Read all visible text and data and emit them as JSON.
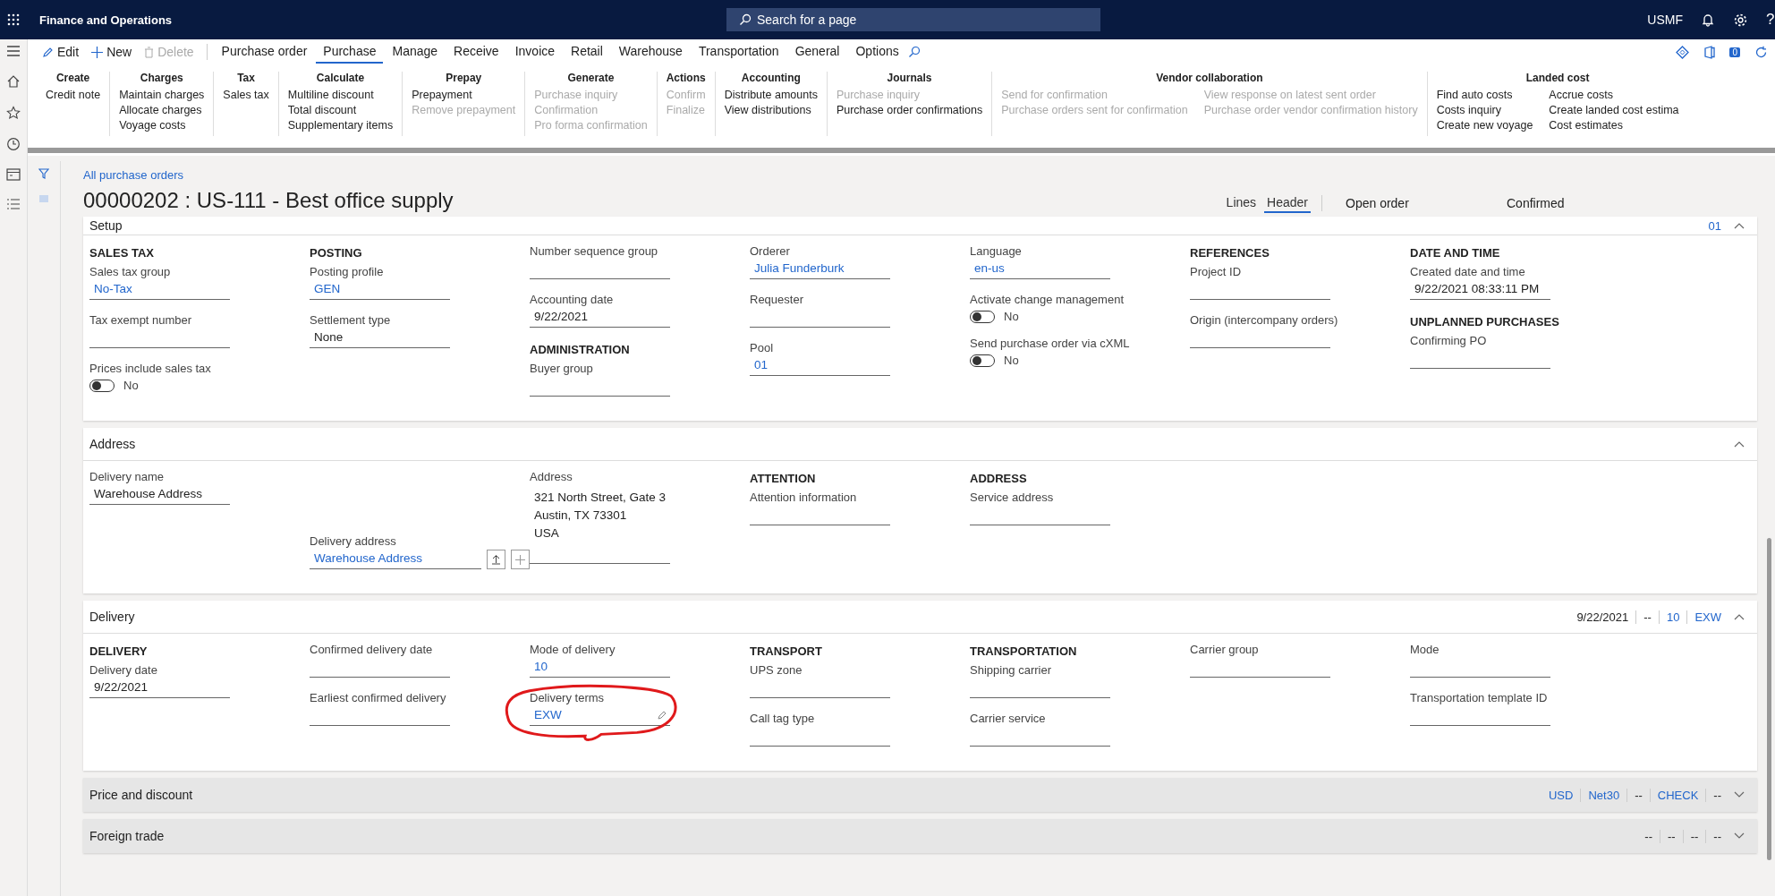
{
  "app": {
    "title": "Finance and Operations",
    "search_placeholder": "Search for a page",
    "company": "USMF",
    "help_label": "?",
    "notification_count": "0"
  },
  "action_bar": {
    "actions": [
      {
        "kind": "edit",
        "label": "Edit",
        "disabled": false
      },
      {
        "kind": "new",
        "label": "New",
        "disabled": false
      },
      {
        "kind": "delete",
        "label": "Delete",
        "disabled": true
      }
    ],
    "tabs": [
      {
        "label": "Purchase order",
        "selected": false
      },
      {
        "label": "Purchase",
        "selected": true
      },
      {
        "label": "Manage",
        "selected": false
      },
      {
        "label": "Receive",
        "selected": false
      },
      {
        "label": "Invoice",
        "selected": false
      },
      {
        "label": "Retail",
        "selected": false
      },
      {
        "label": "Warehouse",
        "selected": false
      },
      {
        "label": "Transportation",
        "selected": false
      },
      {
        "label": "General",
        "selected": false
      },
      {
        "label": "Options",
        "selected": false
      }
    ]
  },
  "ribbon": [
    {
      "title": "Create",
      "columns": [
        [
          {
            "label": "Credit note",
            "disabled": false
          }
        ]
      ]
    },
    {
      "title": "Charges",
      "columns": [
        [
          {
            "label": "Maintain charges",
            "disabled": false
          },
          {
            "label": "Allocate charges",
            "disabled": false
          },
          {
            "label": "Voyage costs",
            "disabled": false
          }
        ]
      ]
    },
    {
      "title": "Tax",
      "columns": [
        [
          {
            "label": "Sales tax",
            "disabled": false
          }
        ]
      ]
    },
    {
      "title": "Calculate",
      "columns": [
        [
          {
            "label": "Multiline discount",
            "disabled": false
          },
          {
            "label": "Total discount",
            "disabled": false
          },
          {
            "label": "Supplementary items",
            "disabled": false
          }
        ]
      ]
    },
    {
      "title": "Prepay",
      "columns": [
        [
          {
            "label": "Prepayment",
            "disabled": false
          },
          {
            "label": "Remove prepayment",
            "disabled": true
          }
        ]
      ]
    },
    {
      "title": "Generate",
      "columns": [
        [
          {
            "label": "Purchase inquiry",
            "disabled": true
          },
          {
            "label": "Confirmation",
            "disabled": true
          },
          {
            "label": "Pro forma confirmation",
            "disabled": true
          }
        ]
      ]
    },
    {
      "title": "Actions",
      "columns": [
        [
          {
            "label": "Confirm",
            "disabled": true
          },
          {
            "label": "Finalize",
            "disabled": true
          }
        ]
      ]
    },
    {
      "title": "Accounting",
      "columns": [
        [
          {
            "label": "Distribute amounts",
            "disabled": false
          },
          {
            "label": "View distributions",
            "disabled": false
          }
        ]
      ]
    },
    {
      "title": "Journals",
      "columns": [
        [
          {
            "label": "Purchase inquiry",
            "disabled": true
          },
          {
            "label": "Purchase order confirmations",
            "disabled": false
          }
        ]
      ]
    },
    {
      "title": "Vendor collaboration",
      "columns": [
        [
          {
            "label": "Send for confirmation",
            "disabled": true
          },
          {
            "label": "Purchase orders sent for confirmation",
            "disabled": true
          }
        ],
        [
          {
            "label": "View response on latest sent order",
            "disabled": true
          },
          {
            "label": "Purchase order vendor confirmation history",
            "disabled": true
          }
        ]
      ]
    },
    {
      "title": "Landed cost",
      "columns": [
        [
          {
            "label": "Find auto costs",
            "disabled": false
          },
          {
            "label": "Costs inquiry",
            "disabled": false
          },
          {
            "label": "Create new voyage",
            "disabled": false
          }
        ],
        [
          {
            "label": "Accrue costs",
            "disabled": false
          },
          {
            "label": "Create landed cost estima",
            "disabled": false
          },
          {
            "label": "Cost estimates",
            "disabled": false
          }
        ]
      ]
    }
  ],
  "header": {
    "breadcrumb": "All purchase orders",
    "title": "00000202 : US-111 - Best office supply",
    "views": [
      {
        "label": "Lines",
        "selected": false
      },
      {
        "label": "Header",
        "selected": true
      }
    ],
    "status": [
      "Open order",
      "Confirmed"
    ]
  },
  "sections": [
    {
      "title": "Setup",
      "expanded": true,
      "summary": [
        {
          "text": "01",
          "link": true
        }
      ],
      "columns": [
        [
          {
            "kind": "heading",
            "text": "SALES TAX"
          },
          {
            "kind": "field",
            "label": "Sales tax group",
            "value": "No-Tax",
            "link": true
          },
          {
            "kind": "field",
            "label": "Tax exempt number"
          },
          {
            "kind": "toggle",
            "label": "Prices include sales tax",
            "on": false,
            "state_text": "No"
          }
        ],
        [
          {
            "kind": "heading",
            "text": "POSTING"
          },
          {
            "kind": "field",
            "label": "Posting profile",
            "value": "GEN",
            "link": true
          },
          {
            "kind": "field",
            "label": "Settlement type",
            "value": "None",
            "link": false
          }
        ],
        [
          {
            "kind": "field",
            "label": "Number sequence group"
          },
          {
            "kind": "field",
            "label": "Accounting date",
            "value": "9/22/2021",
            "link": false
          },
          {
            "kind": "heading",
            "text": "ADMINISTRATION"
          },
          {
            "kind": "field",
            "label": "Buyer group"
          }
        ],
        [
          {
            "kind": "field",
            "label": "Orderer",
            "value": "Julia Funderburk",
            "link": true
          },
          {
            "kind": "field",
            "label": "Requester"
          },
          {
            "kind": "field",
            "label": "Pool",
            "value": "01",
            "link": true
          }
        ],
        [
          {
            "kind": "field",
            "label": "Language",
            "value": "en-us",
            "link": true
          },
          {
            "kind": "toggle",
            "label": "Activate change management",
            "on": false,
            "state_text": "No"
          },
          {
            "kind": "toggle",
            "label": "Send purchase order via cXML",
            "on": false,
            "state_text": "No"
          }
        ],
        [
          {
            "kind": "heading",
            "text": "REFERENCES"
          },
          {
            "kind": "field",
            "label": "Project ID"
          },
          {
            "kind": "field",
            "label": "Origin (intercompany orders)"
          }
        ],
        [
          {
            "kind": "heading",
            "text": "DATE AND TIME"
          },
          {
            "kind": "field",
            "label": "Created date and time",
            "value": "9/22/2021 08:33:11 PM",
            "link": false
          },
          {
            "kind": "heading",
            "text": "UNPLANNED PURCHASES"
          },
          {
            "kind": "field",
            "label": "Confirming PO"
          }
        ]
      ]
    },
    {
      "title": "Address",
      "expanded": true,
      "columns": [
        [
          {
            "kind": "field",
            "label": "Delivery name",
            "value": "Warehouse Address",
            "link": false
          }
        ],
        [
          {
            "kind": "lookup",
            "label": "Delivery address",
            "value": "Warehouse Address",
            "link": true
          }
        ],
        [
          {
            "kind": "address",
            "label": "Address",
            "lines": [
              "321 North Street, Gate 3",
              "Austin, TX 73301",
              "USA"
            ]
          }
        ],
        [
          {
            "kind": "heading",
            "text": "ATTENTION"
          },
          {
            "kind": "field",
            "label": "Attention information"
          }
        ],
        [
          {
            "kind": "heading",
            "text": "ADDRESS"
          },
          {
            "kind": "field",
            "label": "Service address"
          }
        ]
      ]
    },
    {
      "title": "Delivery",
      "expanded": true,
      "summary": [
        {
          "text": "9/22/2021",
          "link": false
        },
        {
          "text": "--",
          "link": false
        },
        {
          "text": "10",
          "link": true
        },
        {
          "text": "EXW",
          "link": true
        }
      ],
      "columns": [
        [
          {
            "kind": "heading",
            "text": "DELIVERY"
          },
          {
            "kind": "field",
            "label": "Delivery date",
            "value": "9/22/2021",
            "link": false
          }
        ],
        [
          {
            "kind": "field",
            "label": "Confirmed delivery date"
          },
          {
            "kind": "field",
            "label": "Earliest confirmed delivery"
          }
        ],
        [
          {
            "kind": "field",
            "label": "Mode of delivery",
            "value": "10",
            "link": true
          },
          {
            "kind": "field",
            "label": "Delivery terms",
            "value": "EXW",
            "link": true,
            "highlighted": true
          }
        ],
        [
          {
            "kind": "heading",
            "text": "TRANSPORT"
          },
          {
            "kind": "field",
            "label": "UPS zone"
          },
          {
            "kind": "field",
            "label": "Call tag type"
          }
        ],
        [
          {
            "kind": "heading",
            "text": "TRANSPORTATION"
          },
          {
            "kind": "field",
            "label": "Shipping carrier"
          },
          {
            "kind": "field",
            "label": "Carrier service"
          }
        ],
        [
          {
            "kind": "field",
            "label": "Carrier group"
          }
        ],
        [
          {
            "kind": "field",
            "label": "Mode"
          },
          {
            "kind": "field",
            "label": "Transportation template ID"
          }
        ]
      ]
    },
    {
      "title": "Price and discount",
      "expanded": false,
      "summary": [
        {
          "text": "USD",
          "link": true
        },
        {
          "text": "Net30",
          "link": true
        },
        {
          "text": "--",
          "link": false
        },
        {
          "text": "CHECK",
          "link": true
        },
        {
          "text": "--",
          "link": false
        }
      ]
    },
    {
      "title": "Foreign trade",
      "expanded": false,
      "summary": [
        {
          "text": "--",
          "link": false
        },
        {
          "text": "--",
          "link": false
        },
        {
          "text": "--",
          "link": false
        },
        {
          "text": "--",
          "link": false
        }
      ]
    }
  ]
}
